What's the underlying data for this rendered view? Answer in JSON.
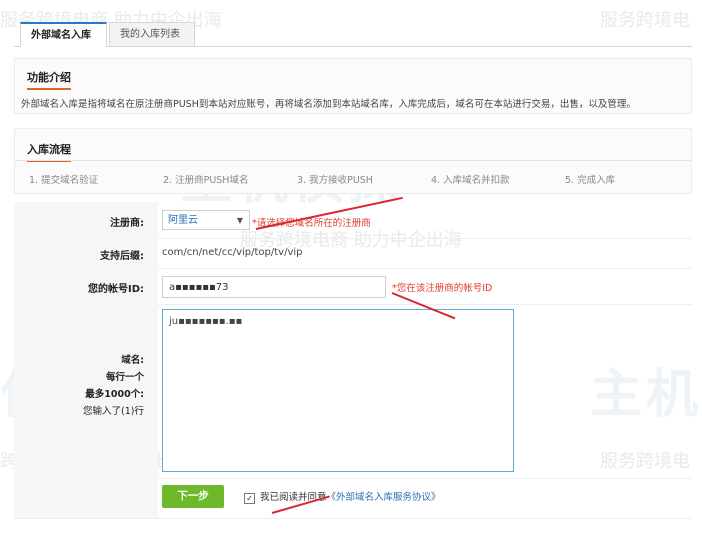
{
  "tabs": [
    {
      "label": "外部域名入库",
      "active": true
    },
    {
      "label": "我的入库列表",
      "active": false
    }
  ],
  "intro": {
    "title": "功能介绍",
    "text": "外部域名入库是指将域名在原注册商PUSH到本站对应账号，再将域名添加到本站域名库，入库完成后，域名可在本站进行交易，出售，以及管理。"
  },
  "flow": {
    "title": "入库流程",
    "steps": [
      "1. 提交域名验证",
      "2. 注册商PUSH域名",
      "3. 我方接收PUSH",
      "4. 入库域名并扣款",
      "5. 完成入库"
    ]
  },
  "form": {
    "registrar_label": "注册商:",
    "registrar_value": "阿里云",
    "registrar_note": "*请选择您域名所在的注册商",
    "suffix_label": "支持后缀:",
    "suffix_value": "com/cn/net/cc/vip/top/tv/vip",
    "account_label": "您的帐号ID:",
    "account_value": "a▪▪▪▪▪▪73",
    "account_note": "*您在该注册商的帐号ID",
    "domains_label_1": "域名:",
    "domains_label_2": "每行一个",
    "domains_label_3": "最多1000个:",
    "domains_count": "您输入了(1)行",
    "domains_value": "ju▪▪▪▪▪▪▪.▪▪"
  },
  "submit": {
    "button_label": "下一步",
    "agree_checked": true,
    "agree_text": "我已阅读并同意",
    "agree_link": "《外部域名入库服务协议》"
  },
  "watermark": {
    "slogan_a": "服务跨境电商  助力中企出海",
    "slogan_b": "服务跨境电",
    "slogan_c": "跨境电商  助力中企出海",
    "logo_a": "主机侦探",
    "logo_b": "侦探",
    "logo_c": "主机"
  },
  "colors": {
    "accent_orange": "#e0632b",
    "note_red": "#e03a2f",
    "button_green": "#6eb92b",
    "link_blue": "#2a6fb6"
  }
}
